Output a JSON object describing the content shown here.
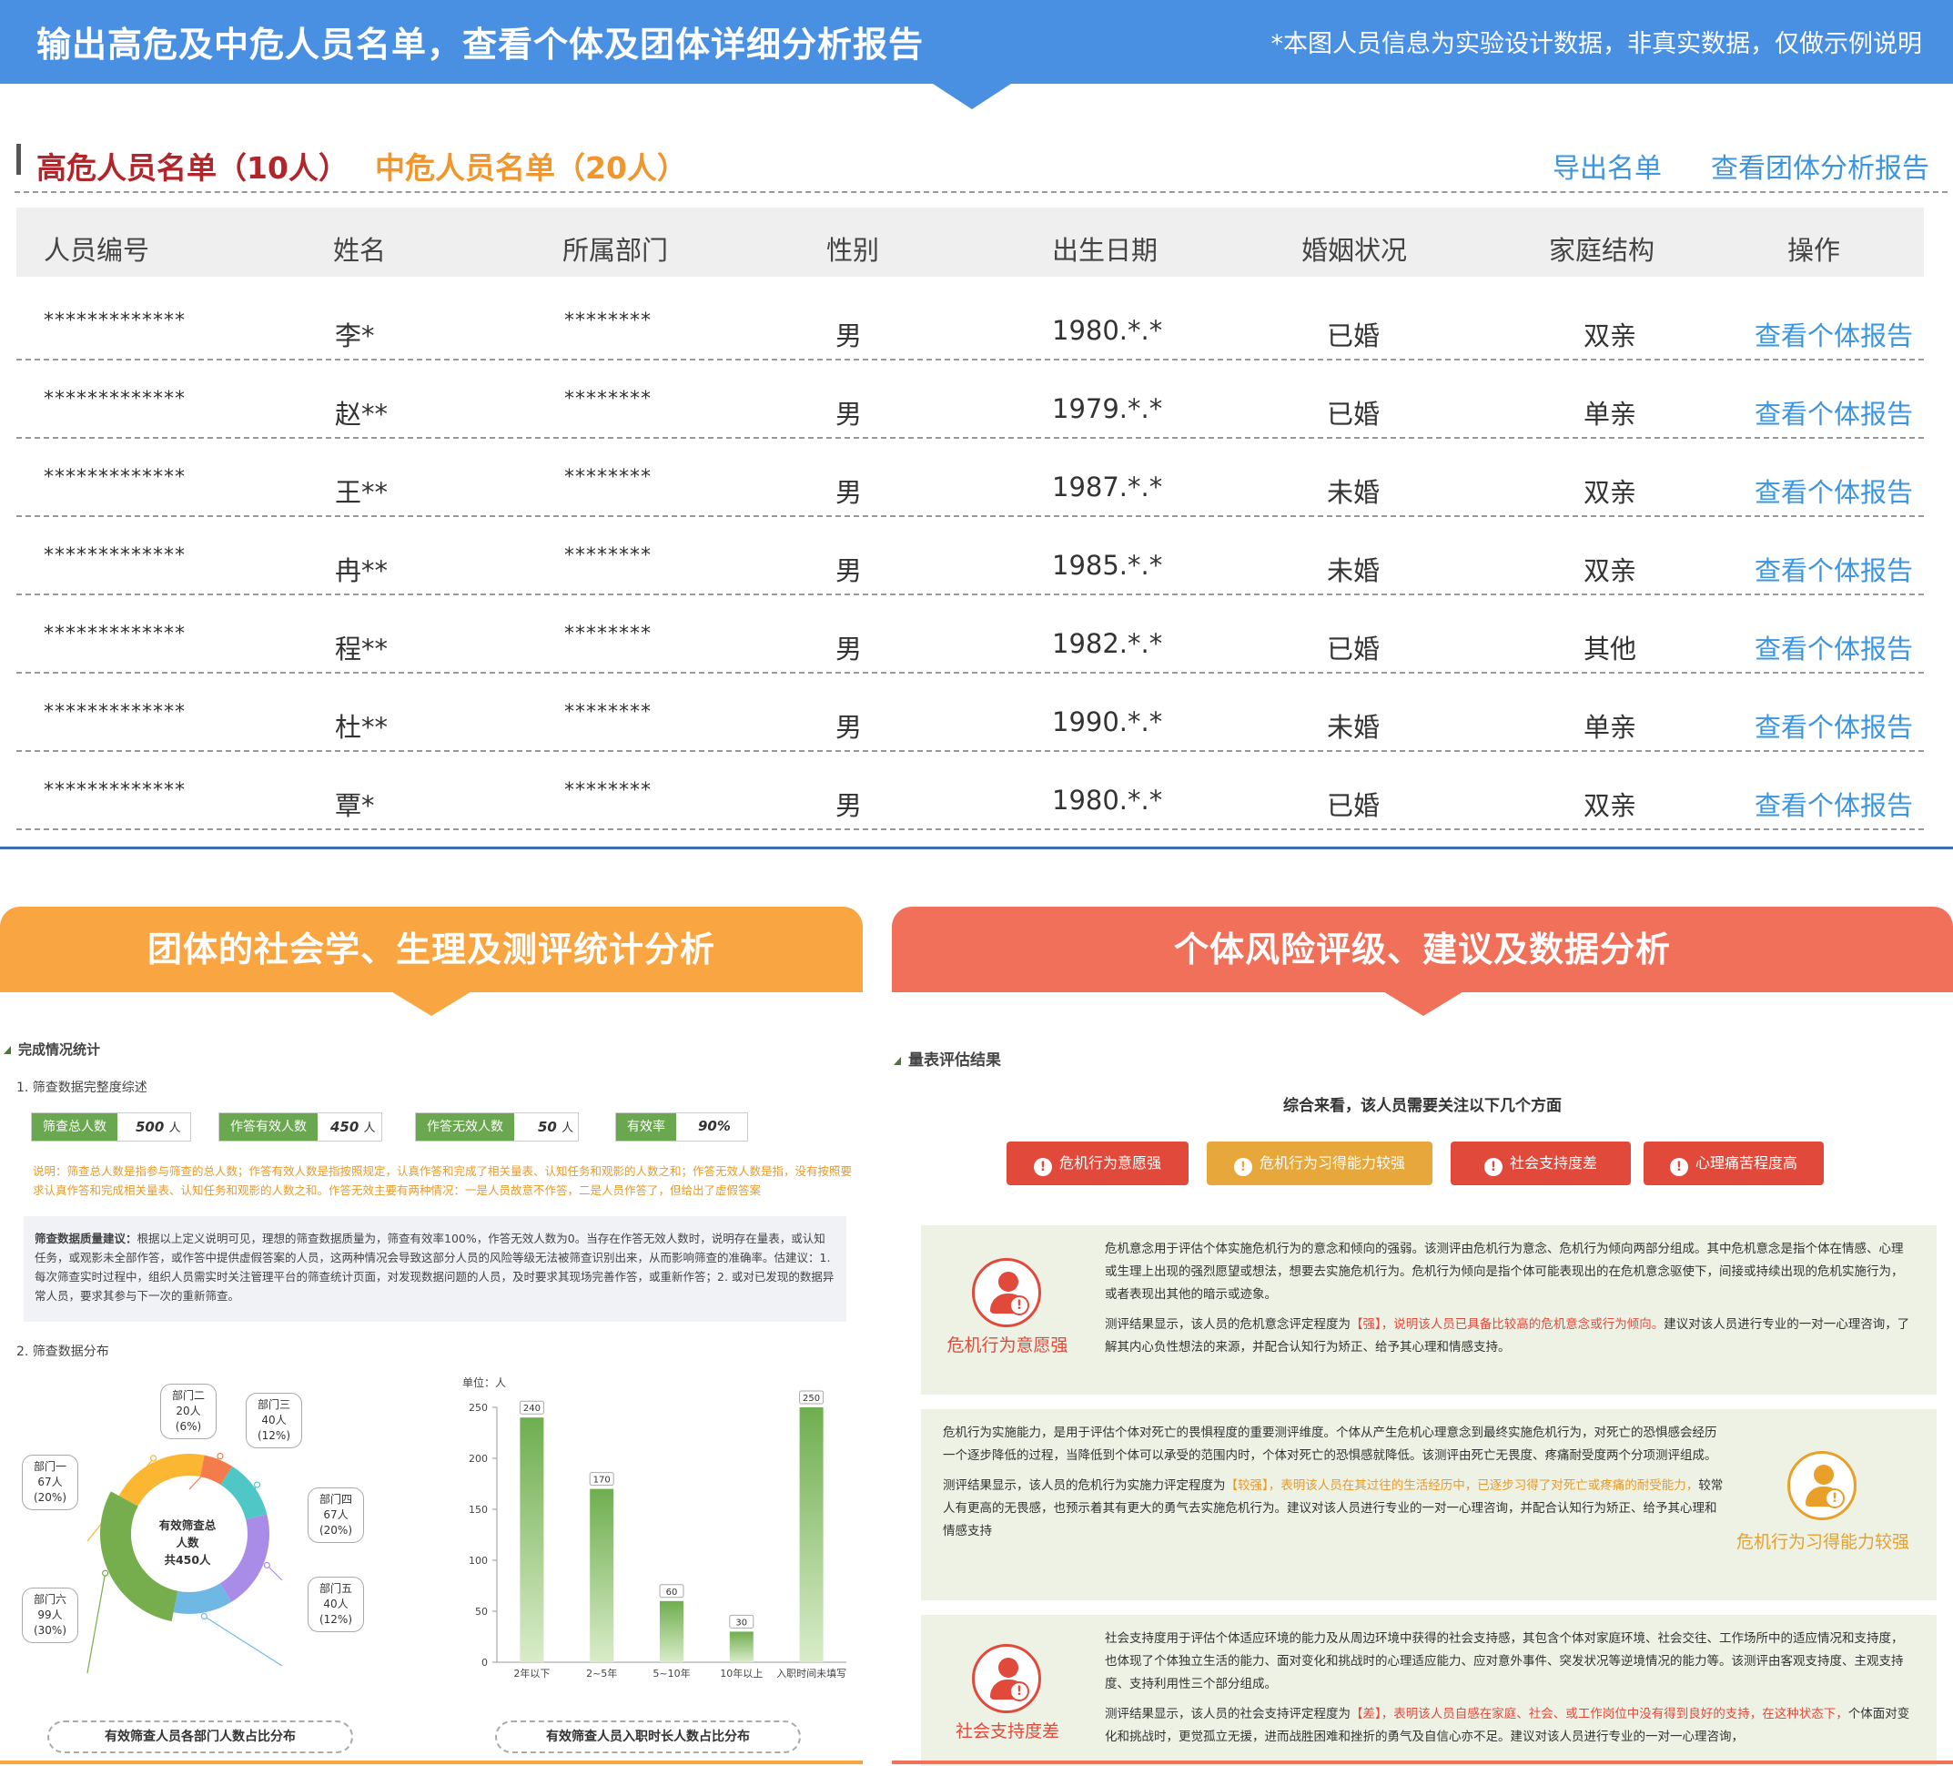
{
  "banner": {
    "title": "输出高危及中危人员名单，查看个体及团体详细分析报告",
    "note": "*本图人员信息为实验设计数据，非真实数据，仅做示例说明"
  },
  "tabs": {
    "high": "高危人员名单（10人）",
    "mid": "中危人员名单（20人）",
    "export": "导出名单",
    "group_report": "查看团体分析报告"
  },
  "table": {
    "headers": [
      "人员编号",
      "姓名",
      "所属部门",
      "性别",
      "出生日期",
      "婚姻状况",
      "家庭结构",
      "操作"
    ],
    "rows": [
      [
        "*************",
        "李*",
        "********",
        "男",
        "1980.*.*",
        "已婚",
        "双亲",
        "查看个体报告"
      ],
      [
        "*************",
        "赵**",
        "********",
        "男",
        "1979.*.*",
        "已婚",
        "单亲",
        "查看个体报告"
      ],
      [
        "*************",
        "王**",
        "********",
        "男",
        "1987.*.*",
        "未婚",
        "双亲",
        "查看个体报告"
      ],
      [
        "*************",
        "冉**",
        "********",
        "男",
        "1985.*.*",
        "未婚",
        "双亲",
        "查看个体报告"
      ],
      [
        "*************",
        "程**",
        "********",
        "男",
        "1982.*.*",
        "已婚",
        "其他",
        "查看个体报告"
      ],
      [
        "*************",
        "杜**",
        "********",
        "男",
        "1990.*.*",
        "未婚",
        "单亲",
        "查看个体报告"
      ],
      [
        "*************",
        "覃*",
        "********",
        "男",
        "1980.*.*",
        "已婚",
        "双亲",
        "查看个体报告"
      ]
    ]
  },
  "left": {
    "header": "团体的社会学、生理及测评统计分析",
    "section": "完成情况统计",
    "sub1": "1. 筛查数据完整度综述",
    "stats": [
      {
        "label": "筛查总人数",
        "value": "500",
        "unit": "人"
      },
      {
        "label": "作答有效人数",
        "value": "450",
        "unit": "人"
      },
      {
        "label": "作答无效人数",
        "value": "50",
        "unit": "人"
      },
      {
        "label": "有效率",
        "value": "90%",
        "unit": ""
      }
    ],
    "note": "说明：筛查总人数是指参与筛查的总人数；作答有效人数是指按照规定，认真作答和完成了相关量表、认知任务和观影的人数之和；作答无效人数是指，没有按照要求认真作答和完成相关量表、认知任务和观影的人数之和。作答无效主要有两种情况：一是人员故意不作答，二是人员作答了，但给出了虚假答案",
    "quality_title": "筛查数据质量建议：",
    "quality_text": "根据以上定义说明可见，理想的筛查数据质量为，筛查有效率100%，作答无效人数为0。当存在作答无效人数时，说明存在量表，或认知任务，或观影未全部作答，或作答中提供虚假答案的人员，这两种情况会导致这部分人员的风险等级无法被筛查识别出来，从而影响筛查的准确率。估建议：1.每次筛查实时过程中，组织人员需实时关注管理平台的筛查统计页面，对发现数据问题的人员，及时要求其现场完善作答，或重新作答；2. 或对已发现的数据异常人员，要求其参与下一次的重新筛查。",
    "sub2": "2. 筛查数据分布",
    "donut_center": [
      "有效筛查总",
      "人数",
      "共450人"
    ],
    "donut_caption": "有效筛查人员各部门人数占比分布",
    "bar_caption": "有效筛查人员入职时长人数占比分布"
  },
  "chart_data": [
    {
      "type": "pie",
      "title": "有效筛查人员各部门人数占比分布",
      "categories": [
        "部门一",
        "部门二",
        "部门三",
        "部门四",
        "部门五",
        "部门六"
      ],
      "values": [
        67,
        20,
        40,
        67,
        40,
        99
      ],
      "value_labels": [
        "67人",
        "20人",
        "40人",
        "67人",
        "40人",
        "99人"
      ],
      "percent_labels": [
        "(20%)",
        "(6%)",
        "(12%)",
        "(20%)",
        "(12%)",
        "(30%)"
      ],
      "colors": [
        "#fbb632",
        "#f47b4b",
        "#4fc7c6",
        "#a98ce8",
        "#6fb8e3",
        "#76ae4e"
      ]
    },
    {
      "type": "bar",
      "title": "有效筛查人员入职时长人数占比分布",
      "unit_label": "单位：人",
      "categories": [
        "2年以下",
        "2~5年",
        "5~10年",
        "10年以上",
        "入职时间未填写"
      ],
      "values": [
        240,
        170,
        60,
        30,
        250
      ],
      "ylim": [
        0,
        250
      ],
      "yticks": [
        "0",
        "50",
        "100",
        "150",
        "200",
        "250"
      ],
      "grid": false
    }
  ],
  "right": {
    "header": "个体风险评级、建议及数据分析",
    "section": "量表评估结果",
    "summary": "综合来看，该人员需要关注以下几个方面",
    "badges": [
      {
        "label": "危机行为意愿强",
        "color": "#e14a3b"
      },
      {
        "label": "危机行为习得能力较强",
        "color": "#e8a73b"
      },
      {
        "label": "社会支持度差",
        "color": "#e14a3b"
      },
      {
        "label": "心理痛苦程度高",
        "color": "#e14a3b"
      }
    ],
    "cards": [
      {
        "icon_label": "危机行为意愿强",
        "p1": "危机意念用于评估个体实施危机行为的意念和倾向的强弱。该测评由危机行为意念、危机行为倾向两部分组成。其中危机意念是指个体在情感、心理或生理上出现的强烈愿望或想法，想要去实施危机行为。危机行为倾向是指个体可能表现出的在危机意念驱使下，间接或持续出现的危机实施行为，或者表现出其他的暗示或迹象。",
        "p2a": "测评结果显示，该人员的危机意念评定程度为",
        "p2b": "【强】，说明该人员已具备比较高的危机意念或行为倾向。",
        "p2c": "建议对该人员进行专业的一对一心理咨询，了解其内心负性想法的来源，并配合认知行为矫正、给予其心理和情感支持。"
      },
      {
        "icon_label": "危机行为习得能力较强",
        "p1": "危机行为实施能力，是用于评估个体对死亡的畏惧程度的重要测评维度。个体从产生危机心理意念到最终实施危机行为，对死亡的恐惧感会经历一个逐步降低的过程，当降低到个体可以承受的范围内时，个体对死亡的恐惧感就降低。该测评由死亡无畏度、疼痛耐受度两个分项测评组成。",
        "p2a": "测评结果显示，该人员的危机行为实施力评定程度为",
        "p2b": "【较强】，表明该人员在其过往的生活经历中，已逐步习得了对死亡或疼痛的耐受能力，",
        "p2c": "较常人有更高的无畏感，也预示着其有更大的勇气去实施危机行为。建议对该人员进行专业的一对一心理咨询，并配合认知行为矫正、给予其心理和情感支持"
      },
      {
        "icon_label": "社会支持度差",
        "p1": "社会支持度用于评估个体适应环境的能力及从周边环境中获得的社会支持感，其包含个体对家庭环境、社会交往、工作场所中的适应情况和支持度，也体现了个体独立生活的能力、面对变化和挑战时的心理适应能力、应对意外事件、突发状况等逆境情况的能力等。该测评由客观支持度、主观支持度、支持利用性三个部分组成。",
        "p2a": "测评结果显示，该人员的社会支持评定程度为",
        "p2b": "【差】，表明该人员自感在家庭、社会、或工作岗位中没有得到良好的支持，在这种状态下，",
        "p2c": "个体面对变化和挑战时，更觉孤立无援，进而战胜困难和挫折的勇气及自信心亦不足。建议对该人员进行专业的一对一心理咨询，"
      }
    ]
  }
}
